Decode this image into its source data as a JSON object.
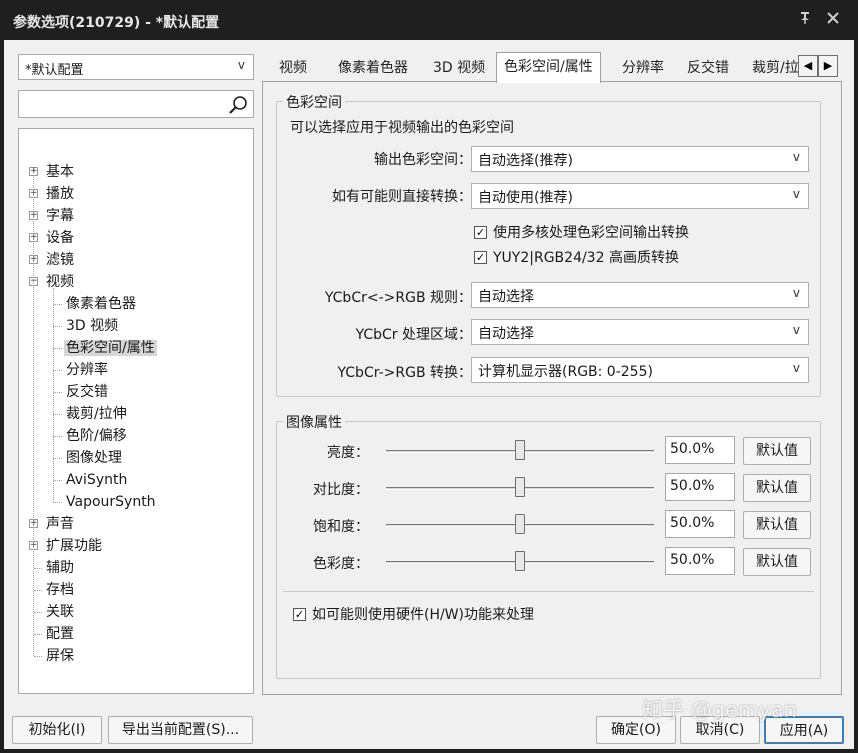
{
  "window": {
    "title": "参数选项(210729) - *默认配置",
    "pin_icon": "pin-icon",
    "close_icon": "close-icon"
  },
  "profile": {
    "selected": "*默认配置"
  },
  "search": {
    "placeholder": "",
    "icon": "search-icon"
  },
  "tree": {
    "items": [
      {
        "label": "基本",
        "expander": "+"
      },
      {
        "label": "播放",
        "expander": "+"
      },
      {
        "label": "字幕",
        "expander": "+"
      },
      {
        "label": "设备",
        "expander": "+"
      },
      {
        "label": "滤镜",
        "expander": "+"
      },
      {
        "label": "视频",
        "expander": "−"
      },
      {
        "label": "像素着色器"
      },
      {
        "label": "3D 视频"
      },
      {
        "label": "色彩空间/属性",
        "selected": true
      },
      {
        "label": "分辨率"
      },
      {
        "label": "反交错"
      },
      {
        "label": "裁剪/拉伸"
      },
      {
        "label": "色阶/偏移"
      },
      {
        "label": "图像处理"
      },
      {
        "label": "AviSynth"
      },
      {
        "label": "VapourSynth"
      },
      {
        "label": "声音",
        "expander": "+"
      },
      {
        "label": "扩展功能",
        "expander": "+"
      },
      {
        "label": "辅助"
      },
      {
        "label": "存档"
      },
      {
        "label": "关联"
      },
      {
        "label": "配置"
      },
      {
        "label": "屏保"
      }
    ]
  },
  "tabs": [
    "视频",
    "像素着色器",
    "3D 视频",
    "色彩空间/属性",
    "分辨率",
    "反交错",
    "裁剪/拉"
  ],
  "tab_scroll": {
    "left_icon": "arrow-left-icon",
    "right_icon": "arrow-right-icon"
  },
  "colorspace": {
    "group_title": "色彩空间",
    "description": "可以选择应用于视频输出的色彩空间",
    "output_label": "输出色彩空间：",
    "output_value": "自动选择(推荐)",
    "direct_label": "如有可能则直接转换：",
    "direct_value": "自动使用(推荐)",
    "multicore_label": "使用多核处理色彩空间输出转换",
    "multicore_checked": true,
    "hq_label": "YUY2|RGB24/32 高画质转换",
    "hq_checked": true,
    "rule_label": "YCbCr<->RGB 规则：",
    "rule_value": "自动选择",
    "range_label": "YCbCr 处理区域：",
    "range_value": "自动选择",
    "convert_label": "YCbCr->RGB 转换：",
    "convert_value": "计算机显示器(RGB: 0-255)"
  },
  "image": {
    "group_title": "图像属性",
    "rows": [
      {
        "label": "亮度：",
        "value": "50.0%",
        "level": 0.5,
        "reset": "默认值"
      },
      {
        "label": "对比度：",
        "value": "50.0%",
        "level": 0.5,
        "reset": "默认值"
      },
      {
        "label": "饱和度：",
        "value": "50.0%",
        "level": 0.5,
        "reset": "默认值"
      },
      {
        "label": "色彩度：",
        "value": "50.0%",
        "level": 0.5,
        "reset": "默认值"
      }
    ],
    "hw_label": "如可能则使用硬件(H/W)功能来处理",
    "hw_checked": true
  },
  "footer": {
    "init": "初始化(I)",
    "export": "导出当前配置(S)...",
    "ok": "确定(O)",
    "cancel": "取消(C)",
    "apply": "应用(A)"
  },
  "watermark": "知乎 @gemyan"
}
